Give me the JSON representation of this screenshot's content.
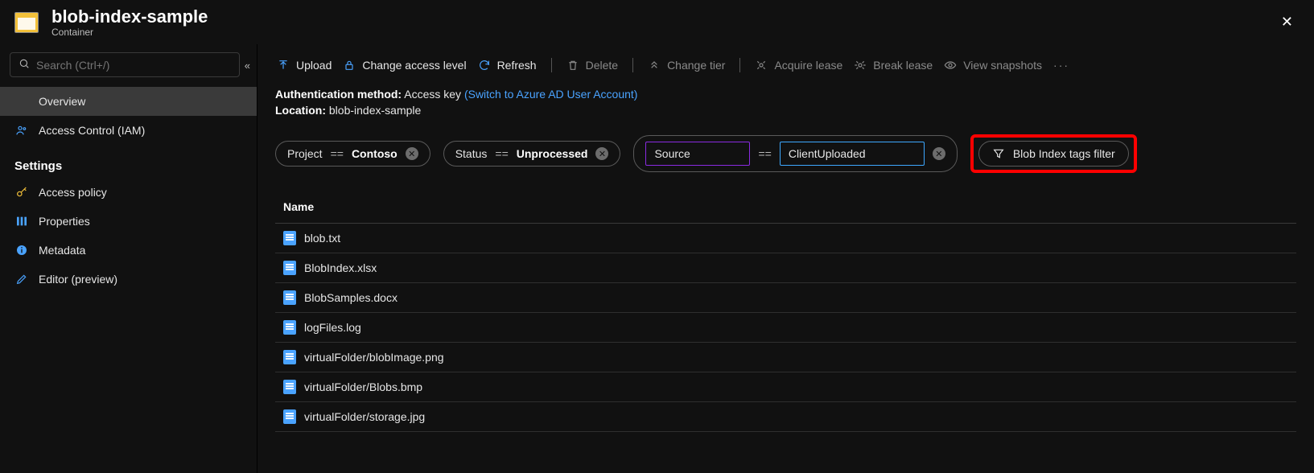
{
  "header": {
    "title": "blob-index-sample",
    "subtitle": "Container"
  },
  "sidebar": {
    "search_placeholder": "Search (Ctrl+/)",
    "items": [
      {
        "label": "Overview",
        "icon": "container-icon",
        "selected": true
      },
      {
        "label": "Access Control (IAM)",
        "icon": "people-icon",
        "selected": false
      }
    ],
    "settings_label": "Settings",
    "settings_items": [
      {
        "label": "Access policy",
        "icon": "key-icon"
      },
      {
        "label": "Properties",
        "icon": "bars-icon"
      },
      {
        "label": "Metadata",
        "icon": "info-icon"
      },
      {
        "label": "Editor (preview)",
        "icon": "pencil-icon"
      }
    ]
  },
  "toolbar": {
    "upload": "Upload",
    "change_access": "Change access level",
    "refresh": "Refresh",
    "delete": "Delete",
    "change_tier": "Change tier",
    "acquire_lease": "Acquire lease",
    "break_lease": "Break lease",
    "view_snapshots": "View snapshots"
  },
  "meta": {
    "auth_label": "Authentication method:",
    "auth_value": "Access key",
    "auth_link": "(Switch to Azure AD User Account)",
    "loc_label": "Location:",
    "loc_value": "blob-index-sample"
  },
  "filters": {
    "eq": "==",
    "chips": [
      {
        "key": "Project",
        "value": "Contoso"
      },
      {
        "key": "Status",
        "value": "Unprocessed"
      }
    ],
    "editing": {
      "key": "Source",
      "value": "ClientUploaded"
    },
    "button_label": "Blob Index tags filter"
  },
  "table": {
    "columns": [
      "Name"
    ],
    "rows": [
      "blob.txt",
      "BlobIndex.xlsx",
      "BlobSamples.docx",
      "logFiles.log",
      "virtualFolder/blobImage.png",
      "virtualFolder/Blobs.bmp",
      "virtualFolder/storage.jpg"
    ]
  }
}
